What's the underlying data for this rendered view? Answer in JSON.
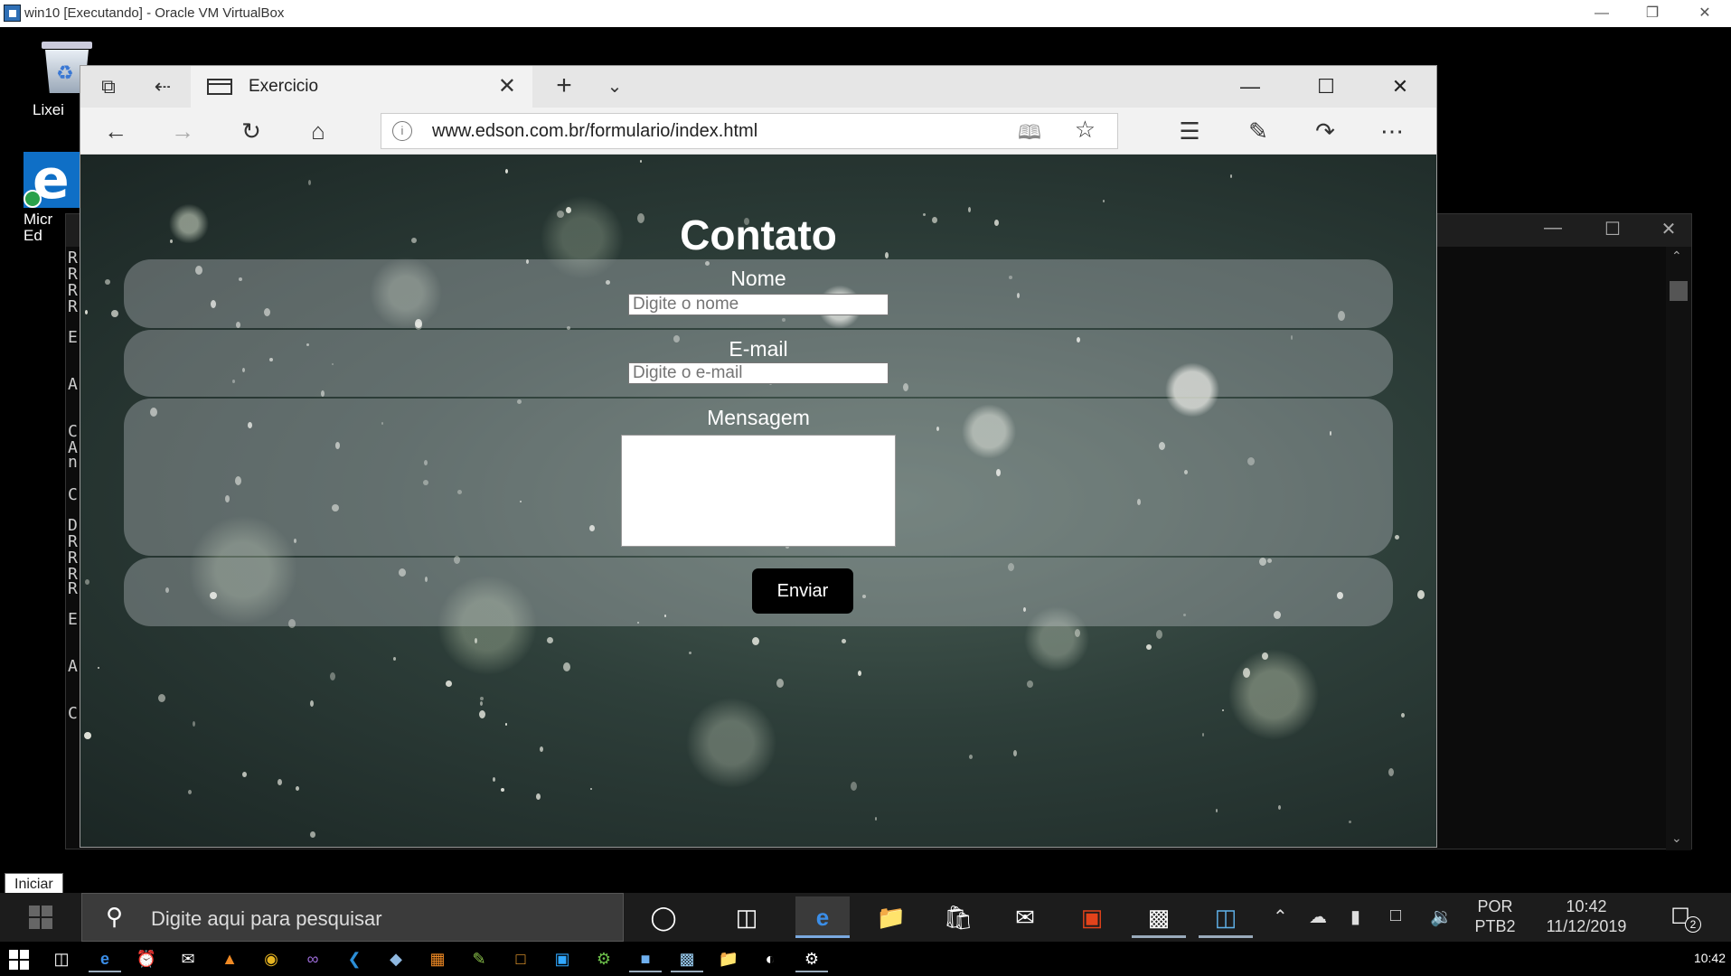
{
  "host_window": {
    "title": "win10 [Executando] - Oracle VM VirtualBox",
    "minimize_icon": "minimize-icon",
    "restore_icon": "restore-icon",
    "close_icon": "close-icon"
  },
  "desktop": {
    "icons": [
      {
        "label": "Lixei",
        "icon": "recycle-bin-icon"
      },
      {
        "label": "Micr\nEd",
        "icon": "edge-icon"
      }
    ],
    "background_letters": [
      "R",
      "R",
      "R",
      "R",
      "E",
      "A",
      "C",
      "A",
      "n",
      "C",
      "D",
      "R",
      "R",
      "R",
      "R",
      "E",
      "A",
      "C"
    ]
  },
  "browser": {
    "tab_title": "Exercicio",
    "url": "www.edson.com.br/formulario/index.html",
    "nav": {
      "back_icon": "back-arrow-icon",
      "forward_icon": "forward-arrow-icon",
      "refresh_icon": "refresh-icon",
      "home_icon": "home-icon"
    },
    "toolbar_icons": [
      "favorites-icon",
      "pen-icon",
      "share-icon",
      "more-icon"
    ],
    "accent": "#0f6fc6"
  },
  "form": {
    "title": "Contato",
    "name_label": "Nome",
    "name_placeholder": "Digite o nome",
    "email_label": "E-mail",
    "email_placeholder": "Digite o e-mail",
    "message_label": "Mensagem",
    "submit_label": "Enviar",
    "panel_color": "rgba(210,215,220,0.32)",
    "button_color": "#000000"
  },
  "guest_taskbar": {
    "tooltip": "Iniciar",
    "search_placeholder": "Digite aqui para pesquisar",
    "pinned": [
      "cortana-icon",
      "task-view-icon",
      "edge-icon",
      "file-explorer-icon",
      "store-icon",
      "mail-icon",
      "office-icon",
      "cmd-icon",
      "remote-desktop-icon"
    ],
    "language": [
      "POR",
      "PTB2"
    ],
    "time": "10:42",
    "date": "11/12/2019",
    "notifications_count": "2"
  },
  "host_taskbar": {
    "time": "10:42"
  }
}
